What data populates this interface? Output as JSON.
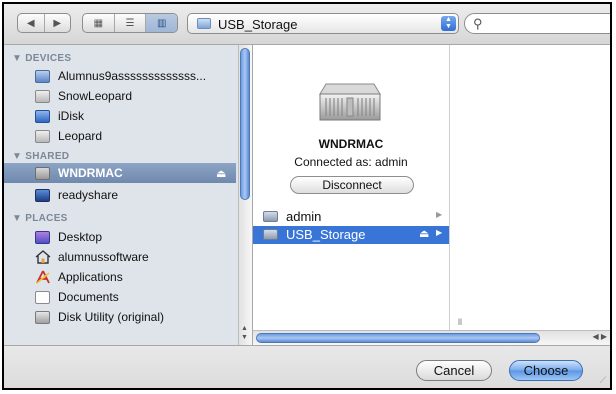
{
  "toolbar": {
    "nav_back_icon": "back-arrow-icon",
    "nav_forward_icon": "forward-arrow-icon",
    "view_modes": [
      "icon-view-icon",
      "list-view-icon",
      "column-view-icon"
    ],
    "location": "USB_Storage",
    "search_placeholder": ""
  },
  "sidebar": {
    "devices_header": "DEVICES",
    "devices": [
      {
        "label": "Alumnus9asssssssssssss...",
        "icon": "computer-icon"
      },
      {
        "label": "SnowLeopard",
        "icon": "hard-disk-icon"
      },
      {
        "label": "iDisk",
        "icon": "idisk-icon"
      },
      {
        "label": "Leopard",
        "icon": "hard-disk-icon"
      }
    ],
    "shared_header": "SHARED",
    "shared": [
      {
        "label": "WNDRMAC",
        "icon": "server-icon",
        "selected": true
      },
      {
        "label": "readyshare",
        "icon": "network-monitor-icon"
      }
    ],
    "places_header": "PLACES",
    "places": [
      {
        "label": "Desktop",
        "icon": "desktop-icon"
      },
      {
        "label": "alumnussoftware",
        "icon": "home-icon"
      },
      {
        "label": "Applications",
        "icon": "applications-icon"
      },
      {
        "label": "Documents",
        "icon": "documents-icon"
      },
      {
        "label": "Disk Utility (original)",
        "icon": "disk-utility-icon"
      }
    ]
  },
  "server": {
    "name": "WNDRMAC",
    "connected_as": "Connected as: admin",
    "disconnect_label": "Disconnect"
  },
  "column1": {
    "items": [
      {
        "label": "admin",
        "selected": false
      },
      {
        "label": "USB_Storage",
        "selected": true
      }
    ]
  },
  "buttons": {
    "cancel": "Cancel",
    "choose": "Choose"
  },
  "colors": {
    "selection": "#3875d7",
    "sidebar_bg": "#dee4ea",
    "sidebar_selected": "#6f89ae"
  }
}
